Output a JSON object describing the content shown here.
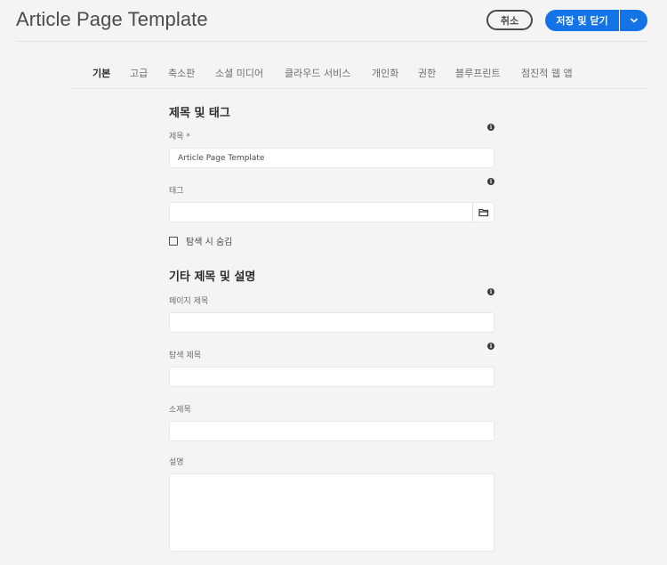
{
  "header": {
    "title": "Article Page Template",
    "cancel_label": "취소",
    "save_label": "저장 및 닫기",
    "dropdown_icon": "chevron-down-icon",
    "accent_color": "#1473e6"
  },
  "tabs": [
    {
      "label": "기본",
      "active": true
    },
    {
      "label": "고급",
      "active": false
    },
    {
      "label": "축소판",
      "active": false
    },
    {
      "label": "소셜 미디어",
      "active": false
    },
    {
      "label": "클라우드 서비스",
      "active": false
    },
    {
      "label": "개인화",
      "active": false
    },
    {
      "label": "권한",
      "active": false
    },
    {
      "label": "블루프린트",
      "active": false
    },
    {
      "label": "점진적 웹 앱",
      "active": false
    }
  ],
  "sections": {
    "title_tags": {
      "heading": "제목 및 태그",
      "title_label": "제목 *",
      "title_value": "Article Page Template",
      "tags_label": "태그",
      "tags_value": "",
      "hide_nav_label": "탐색 시 숨김",
      "hide_nav_checked": false
    },
    "other_titles": {
      "heading": "기타 제목 및 설명",
      "page_title_label": "페이지 제목",
      "page_title_value": "",
      "nav_title_label": "탐색 제목",
      "nav_title_value": "",
      "subtitle_label": "소제목",
      "subtitle_value": "",
      "description_label": "설명",
      "description_value": ""
    }
  },
  "icons": {
    "info": "info-icon",
    "folder": "folder-icon",
    "info_glyph": "i"
  }
}
